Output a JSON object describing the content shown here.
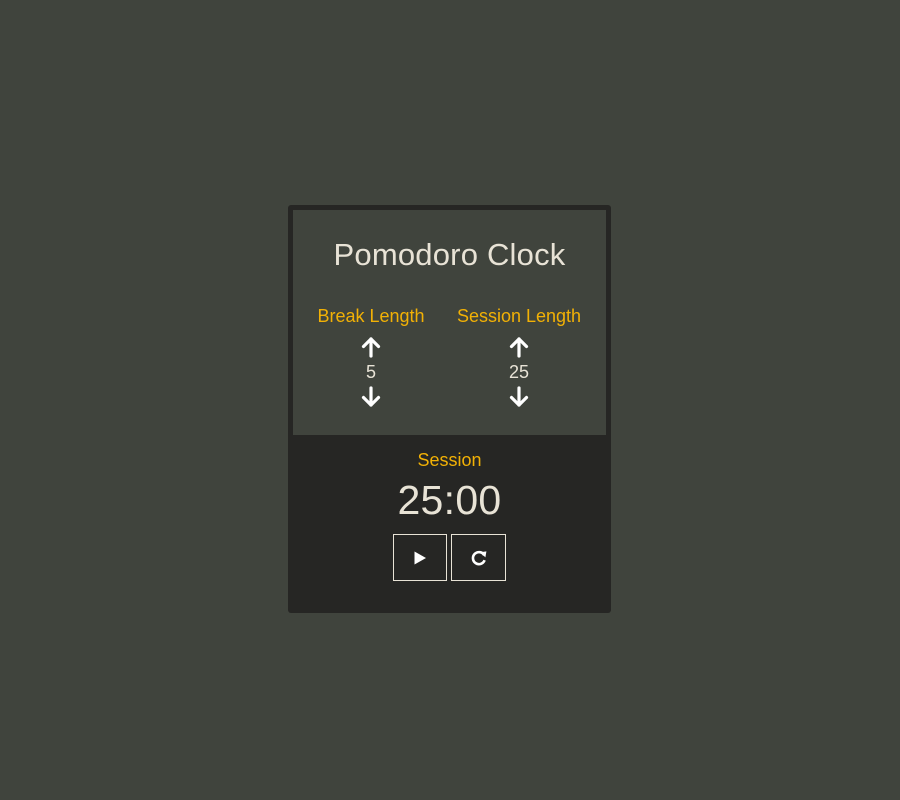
{
  "app": {
    "title": "Pomodoro Clock"
  },
  "break_length": {
    "label": "Break Length",
    "value": "5",
    "increment_icon": "arrow-up-icon",
    "decrement_icon": "arrow-down-icon"
  },
  "session_length": {
    "label": "Session Length",
    "value": "25",
    "increment_icon": "arrow-up-icon",
    "decrement_icon": "arrow-down-icon"
  },
  "timer": {
    "mode_label": "Session",
    "time": "25:00"
  },
  "controls": {
    "play_icon": "play-icon",
    "reset_icon": "reset-icon"
  },
  "colors": {
    "background": "#40443d",
    "card": "#262624",
    "accent": "#f2b105",
    "text": "#e8e3d6"
  }
}
